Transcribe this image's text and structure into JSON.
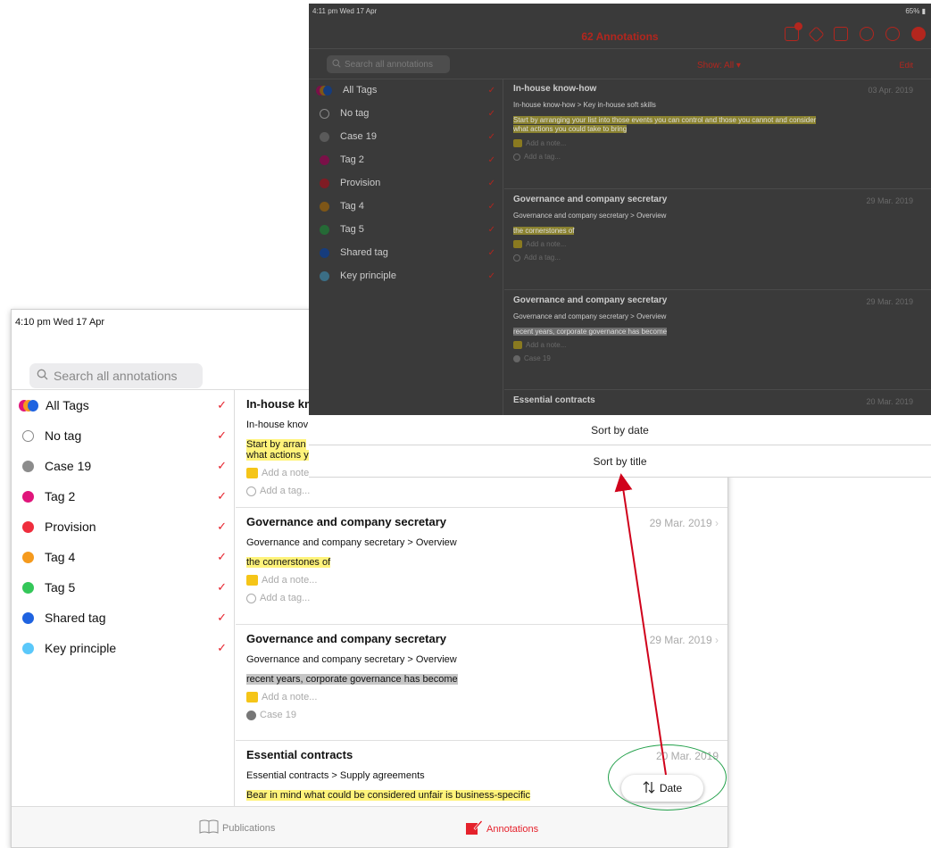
{
  "back": {
    "status": "4:10 pm  Wed 17 Apr",
    "search_placeholder": "Search all annotations",
    "tags": [
      {
        "label": "All Tags",
        "checked": "✓"
      },
      {
        "label": "No tag",
        "checked": "✓",
        "color": ""
      },
      {
        "label": "Case 19",
        "checked": "✓",
        "color": "#8c8c8c"
      },
      {
        "label": "Tag 2",
        "checked": "✓",
        "color": "#e0157b"
      },
      {
        "label": "Provision",
        "checked": "✓",
        "color": "#ef2d3d"
      },
      {
        "label": "Tag 4",
        "checked": "✓",
        "color": "#f59a1d"
      },
      {
        "label": "Tag 5",
        "checked": "✓",
        "color": "#34c759"
      },
      {
        "label": "Shared tag",
        "checked": "✓",
        "color": "#1f63e0"
      },
      {
        "label": "Key principle",
        "checked": "✓",
        "color": "#5ac8fa"
      }
    ],
    "annotations": [
      {
        "title": "In-house kno",
        "date": "",
        "path": "In-house knov",
        "highlight": "Start by arran",
        "highlight2": "what actions y",
        "note": "Add a note...",
        "tag": "Add a tag..."
      },
      {
        "title": "Governance and company secretary",
        "date": "29 Mar. 2019",
        "path": "Governance and company secretary > Overview",
        "highlight": "the cornerstones of",
        "note": "Add a note...",
        "tag": "Add a tag..."
      },
      {
        "title": "Governance and company secretary",
        "date": "29 Mar. 2019",
        "path": "Governance and company secretary > Overview",
        "highlight": "recent years, corporate governance has become",
        "note": "Add a note...",
        "tag": "Case 19"
      },
      {
        "title": "Essential contracts",
        "date": "20 Mar. 2019",
        "path": "Essential contracts > Supply agreements",
        "highlight": "Bear in mind what could be considered unfair is business-specific"
      }
    ],
    "tabs": {
      "publications": "Publications",
      "annotations": "Annotations"
    },
    "sort_pill": "Date"
  },
  "front": {
    "status": "4:11 pm  Wed 17 Apr",
    "battery": "65%",
    "title": "62 Annotations",
    "search_placeholder": "Search all annotations",
    "show": "Show: All ▾",
    "edit": "Edit",
    "tags": [
      {
        "label": "All Tags",
        "checked": "✓"
      },
      {
        "label": "No tag",
        "checked": "✓"
      },
      {
        "label": "Case 19",
        "checked": "✓",
        "color": "#5a5a5a"
      },
      {
        "label": "Tag 2",
        "checked": "✓",
        "color": "#7a1048"
      },
      {
        "label": "Provision",
        "checked": "✓",
        "color": "#7f1c24"
      },
      {
        "label": "Tag 4",
        "checked": "✓",
        "color": "#7e5617"
      },
      {
        "label": "Tag 5",
        "checked": "✓",
        "color": "#256a36"
      },
      {
        "label": "Shared tag",
        "checked": "✓",
        "color": "#163c7c"
      },
      {
        "label": "Key principle",
        "checked": "✓",
        "color": "#3b6e85"
      }
    ],
    "annotations": [
      {
        "title": "In-house know-how",
        "date": "03 Apr. 2019",
        "path": "In-house know-how > Key in-house soft skills",
        "highlight": "Start by arranging your list into those events you can control and those you cannot and consider",
        "highlight2": "what actions you could take to bring",
        "note": "Add a note...",
        "tag": "Add a tag..."
      },
      {
        "title": "Governance and company secretary",
        "date": "29 Mar. 2019",
        "path": "Governance and company secretary > Overview",
        "highlight": "the cornerstones of",
        "note": "Add a note...",
        "tag": "Add a tag..."
      },
      {
        "title": "Governance and company secretary",
        "date": "29 Mar. 2019",
        "path": "Governance and company secretary > Overview",
        "highlight": "recent years, corporate governance has become",
        "note": "Add a note...",
        "tag": "Case 19"
      },
      {
        "title": "Essential contracts",
        "date": "20 Mar. 2019"
      }
    ],
    "menu": {
      "sort_date": "Sort by date",
      "sort_title": "Sort by title"
    }
  },
  "colors": {
    "accent": "#e5222c",
    "callout_arrow": "#d0021b",
    "callout_ring": "#22a04a"
  },
  "icons": [
    "search-icon",
    "book-icon",
    "annotation-icon",
    "sort-icon",
    "checkmark-icon",
    "inbox-icon",
    "tag-icon",
    "share-icon",
    "history-icon",
    "help-icon",
    "settings-icon"
  ]
}
